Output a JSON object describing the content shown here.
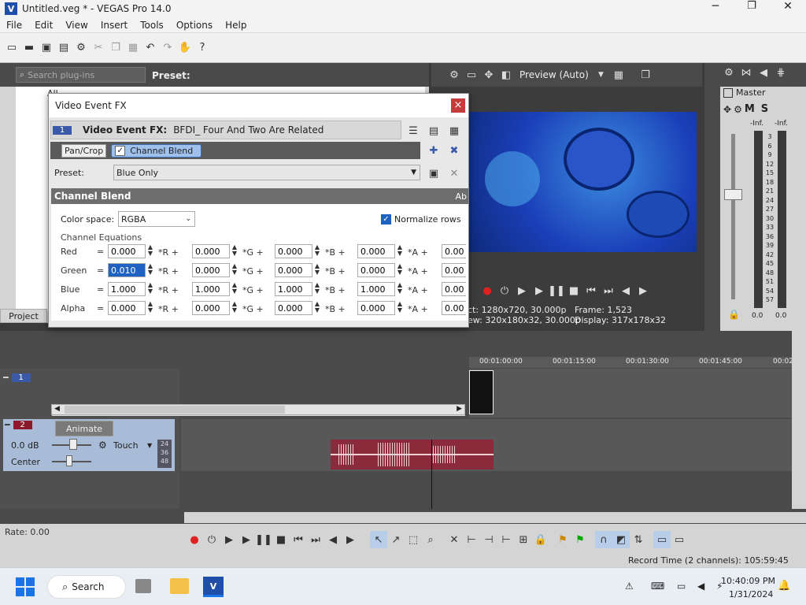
{
  "window": {
    "title": "Untitled.veg * - VEGAS Pro 14.0"
  },
  "menu": [
    "File",
    "Edit",
    "View",
    "Insert",
    "Tools",
    "Options",
    "Help"
  ],
  "plugins": {
    "search_placeholder": "Search plug-ins",
    "preset_label": "Preset:",
    "project_tab": "Project",
    "tree_item": "All"
  },
  "dialog": {
    "title": "Video Event FX",
    "close": "×",
    "chain_label": "Video Event FX:",
    "chain_value": "BFDI_ Four And Two Are Related",
    "chain_num": "1",
    "fx_tabs": [
      "Pan/Crop",
      "Channel Blend"
    ],
    "preset_label": "Preset:",
    "preset_value": "Blue Only",
    "section_title": "Channel Blend",
    "section_right": "Ab",
    "color_space_label": "Color space:",
    "color_space_value": "RGBA",
    "normalize_label": "Normalize rows",
    "equations_label": "Channel Equations",
    "ops": [
      "*R +",
      "*G +",
      "*B +",
      "*A +"
    ],
    "rows": [
      {
        "name": "Red",
        "eq": "=",
        "vals": [
          "0.000",
          "0.000",
          "0.000",
          "0.000",
          "0.00"
        ]
      },
      {
        "name": "Green",
        "eq": "=",
        "vals": [
          "0.010",
          "0.000",
          "0.000",
          "0.000",
          "0.00"
        ]
      },
      {
        "name": "Blue",
        "eq": "=",
        "vals": [
          "1.000",
          "1.000",
          "1.000",
          "1.000",
          "0.00"
        ]
      },
      {
        "name": "Alpha",
        "eq": "=",
        "vals": [
          "0.000",
          "0.000",
          "0.000",
          "0.000",
          "0.00"
        ]
      }
    ]
  },
  "preview": {
    "mode": "Preview (Auto)",
    "project_info": "ct:  1280x720, 30.000p",
    "preview_info": "ew: 320x180x32, 30.000p",
    "frame_label": "Frame:",
    "frame_value": "1,523",
    "display_label": "Display:",
    "display_value": "317x178x32",
    "accent": "#1a3fb8"
  },
  "mixer": {
    "master": "Master",
    "levels": [
      "-Inf.",
      "-Inf."
    ],
    "scale": [
      "3",
      "6",
      "9",
      "12",
      "15",
      "18",
      "21",
      "24",
      "27",
      "30",
      "33",
      "36",
      "39",
      "42",
      "45",
      "48",
      "51",
      "54",
      "57"
    ],
    "bottom": [
      "0.0",
      "0.0"
    ],
    "ms": [
      "M",
      "S"
    ]
  },
  "timeline": {
    "ruler": [
      "00:01:00:00",
      "00:01:15:00",
      "00:01:30:00",
      "00:01:45:00",
      "00:02"
    ],
    "track1_num": "1",
    "track2_num": "2",
    "animate": "Animate",
    "vol": "0.0 dB",
    "touch": "Touch",
    "pan": "Center",
    "meter_nums": [
      "24",
      "36",
      "48"
    ],
    "rate": "Rate: 0.00"
  },
  "status": {
    "record_time": "Record Time (2 channels): 105:59:45"
  },
  "taskbar": {
    "search": "Search",
    "time": "10:40:09 PM",
    "date": "1/31/2024"
  }
}
